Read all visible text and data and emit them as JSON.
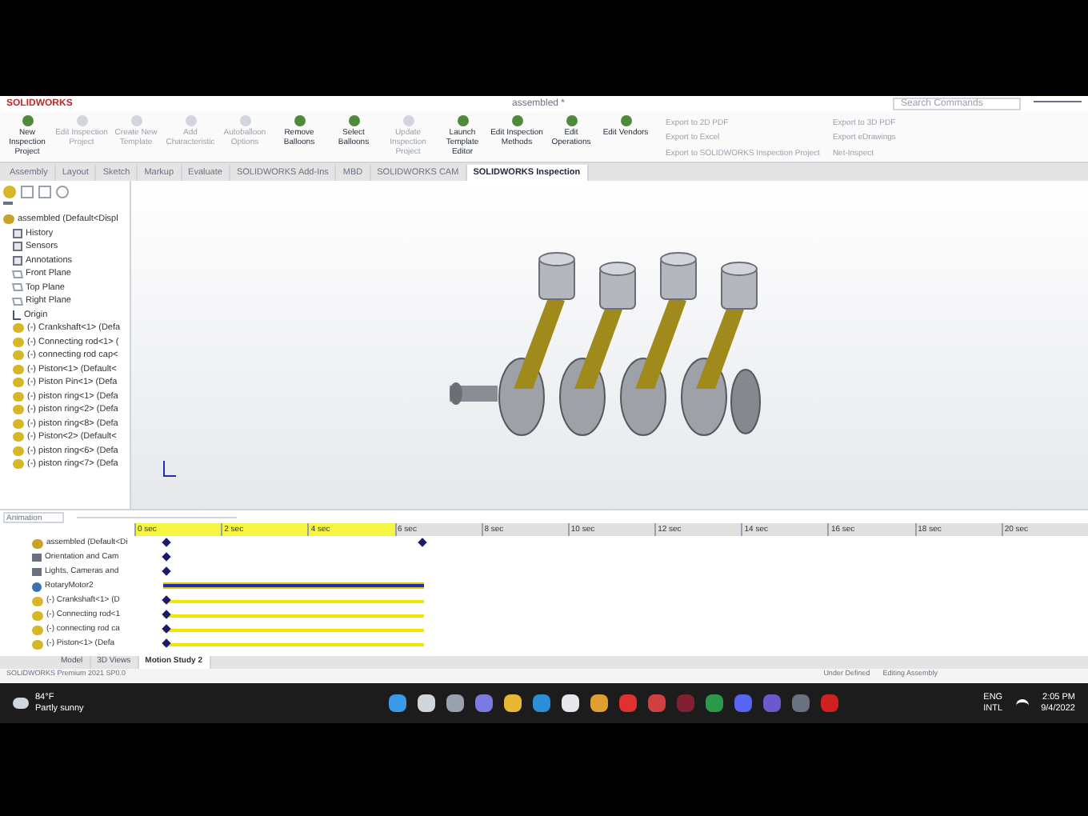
{
  "title_bar": {
    "brand": "SOLIDWORKS",
    "document": "assembled *",
    "search_placeholder": "Search Commands"
  },
  "ribbon": {
    "buttons": [
      {
        "label": "New Inspection Project",
        "disabled": false
      },
      {
        "label": "Edit Inspection Project",
        "disabled": true
      },
      {
        "label": "Create New Template",
        "disabled": true
      },
      {
        "label": "Add Characteristic",
        "disabled": true
      },
      {
        "label": "Autoballoon Options",
        "disabled": true
      },
      {
        "label": "Remove Balloons",
        "disabled": false
      },
      {
        "label": "Select Balloons",
        "disabled": false
      },
      {
        "label": "Update Inspection Project",
        "disabled": true
      },
      {
        "label": "Launch Template Editor",
        "disabled": false
      },
      {
        "label": "Edit Inspection Methods",
        "disabled": false
      },
      {
        "label": "Edit Operations",
        "disabled": false
      },
      {
        "label": "Edit Vendors",
        "disabled": false
      }
    ],
    "exports": [
      {
        "label": "Export to 2D PDF",
        "disabled": true
      },
      {
        "label": "Export to Excel",
        "disabled": true
      },
      {
        "label": "Export to SOLIDWORKS Inspection Project",
        "disabled": true
      },
      {
        "label": "Export to 3D PDF",
        "disabled": true
      },
      {
        "label": "Export eDrawings",
        "disabled": true
      },
      {
        "label": "Net-Inspect",
        "disabled": true
      }
    ]
  },
  "tabs": [
    {
      "label": "Assembly",
      "selected": false
    },
    {
      "label": "Layout",
      "selected": false
    },
    {
      "label": "Sketch",
      "selected": false
    },
    {
      "label": "Markup",
      "selected": false
    },
    {
      "label": "Evaluate",
      "selected": false
    },
    {
      "label": "SOLIDWORKS Add-Ins",
      "selected": false
    },
    {
      "label": "MBD",
      "selected": false
    },
    {
      "label": "SOLIDWORKS CAM",
      "selected": false
    },
    {
      "label": "SOLIDWORKS Inspection",
      "selected": true
    }
  ],
  "feature_tree": {
    "root": "assembled  (Default<Displ",
    "items": [
      {
        "label": "History",
        "kind": "folder"
      },
      {
        "label": "Sensors",
        "kind": "folder"
      },
      {
        "label": "Annotations",
        "kind": "folder"
      },
      {
        "label": "Front Plane",
        "kind": "plane"
      },
      {
        "label": "Top Plane",
        "kind": "plane"
      },
      {
        "label": "Right Plane",
        "kind": "plane"
      },
      {
        "label": "Origin",
        "kind": "origin"
      },
      {
        "label": "(-) Crankshaft<1> (Defa",
        "kind": "part"
      },
      {
        "label": "(-) Connecting rod<1> (",
        "kind": "part"
      },
      {
        "label": "(-) connecting rod cap<",
        "kind": "part"
      },
      {
        "label": "(-) Piston<1> (Default<",
        "kind": "part"
      },
      {
        "label": "(-) Piston Pin<1> (Defa",
        "kind": "part"
      },
      {
        "label": "(-) piston ring<1> (Defa",
        "kind": "part"
      },
      {
        "label": "(-) piston ring<2> (Defa",
        "kind": "part"
      },
      {
        "label": "(-) piston ring<8> (Defa",
        "kind": "part"
      },
      {
        "label": "(-) Piston<2> (Default<",
        "kind": "part"
      },
      {
        "label": "(-) piston ring<6> (Defa",
        "kind": "part"
      },
      {
        "label": "(-) piston ring<7> (Defa",
        "kind": "part"
      }
    ]
  },
  "motion": {
    "study_type": "Animation",
    "ticks": [
      "0 sec",
      "2 sec",
      "4 sec",
      "6 sec",
      "8 sec",
      "10 sec",
      "12 sec",
      "14 sec",
      "16 sec",
      "18 sec",
      "20 sec"
    ],
    "rows": [
      {
        "label": "assembled (Default<Di",
        "kind": "key"
      },
      {
        "label": "Orientation and Cam",
        "kind": "start"
      },
      {
        "label": "Lights, Cameras and",
        "kind": "start"
      },
      {
        "label": "RotaryMotor2",
        "kind": "motor"
      },
      {
        "label": "(-) Crankshaft<1> (D",
        "kind": "part"
      },
      {
        "label": "(-) Connecting rod<1",
        "kind": "part"
      },
      {
        "label": "(-) connecting rod ca",
        "kind": "part"
      },
      {
        "label": "(-) Piston<1> (Defa",
        "kind": "part"
      }
    ]
  },
  "bottom_tabs": [
    {
      "label": "Model",
      "selected": false
    },
    {
      "label": "3D Views",
      "selected": false
    },
    {
      "label": "Motion Study 2",
      "selected": true
    }
  ],
  "status_bar": {
    "product": "SOLIDWORKS Premium 2021 SP0.0",
    "state": "Under Defined",
    "mode": "Editing Assembly"
  },
  "taskbar": {
    "temperature": "84°F",
    "weather": "Partly sunny",
    "language": "ENG",
    "layout": "INTL",
    "time": "2:05 PM",
    "date": "9/4/2022"
  }
}
